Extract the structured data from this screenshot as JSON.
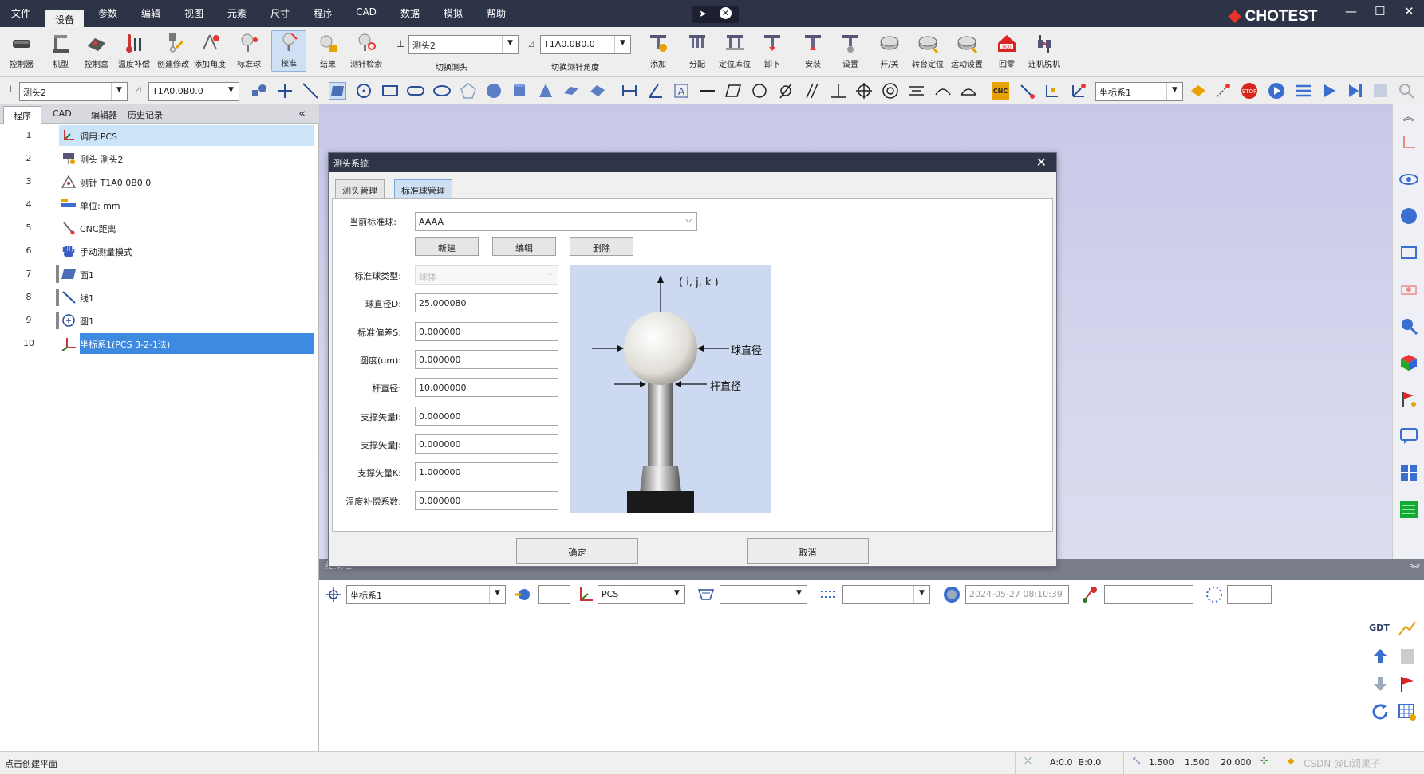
{
  "menubar": {
    "items": [
      "文件",
      "设备",
      "参数",
      "编辑",
      "视图",
      "元素",
      "尺寸",
      "程序",
      "CAD",
      "数据",
      "模拟",
      "帮助"
    ],
    "active": "设备"
  },
  "brand": "CHOTEST",
  "ribbon": {
    "buttons": [
      "控制器",
      "机型",
      "控制盒",
      "温度补偿",
      "创建修改",
      "添加角度",
      "标准球",
      "校准",
      "结果",
      "测针检索"
    ],
    "selected": "校准",
    "probe_select": "测头2",
    "probe_caption": "切换测头",
    "angle_select": "T1A0.0B0.0",
    "angle_caption": "切换测针角度",
    "buttons_right": [
      "添加",
      "分配",
      "定位库位",
      "卸下",
      "安装",
      "设置",
      "开/关",
      "转台定位",
      "运动设置",
      "回零",
      "连机脱机"
    ]
  },
  "toolbar2": {
    "probe_select": "测头2",
    "angle_select": "T1A0.0B0.0",
    "coord_select": "坐标系1",
    "cnc_badge": "CNC"
  },
  "left_panel": {
    "tabs": [
      "程序",
      "CAD",
      "编辑器",
      "历史记录"
    ],
    "active_tab": "程序",
    "collapse_icon": "«",
    "rows": [
      {
        "num": "1",
        "text": "调用:PCS",
        "icon": "axis-call-icon"
      },
      {
        "num": "2",
        "text": "测头 测头2",
        "icon": "probe-icon"
      },
      {
        "num": "3",
        "text": "测针 T1A0.0B0.0",
        "icon": "stylus-icon"
      },
      {
        "num": "4",
        "text": "单位: mm",
        "icon": "ruler-icon"
      },
      {
        "num": "5",
        "text": "CNC距离",
        "icon": "cnc-distance-icon"
      },
      {
        "num": "6",
        "text": "手动测量模式",
        "icon": "hand-icon"
      },
      {
        "num": "7",
        "text": "面1",
        "icon": "plane-icon"
      },
      {
        "num": "8",
        "text": "线1",
        "icon": "line-icon"
      },
      {
        "num": "9",
        "text": "圆1",
        "icon": "circle-icon"
      },
      {
        "num": "10",
        "text": "坐标系1(PCS  3-2-1法)",
        "icon": "coordinate-icon"
      }
    ]
  },
  "dialog": {
    "title": "测头系统",
    "tabs": [
      "测头管理",
      "标准球管理"
    ],
    "active_tab": "标准球管理",
    "current_ball_label": "当前标准球:",
    "current_ball_value": "AAAA",
    "btn_new": "新建",
    "btn_edit": "编辑",
    "btn_delete": "删除",
    "fields": [
      {
        "label": "标准球类型:",
        "value": "球体",
        "disabled": true
      },
      {
        "label": "球直径D:",
        "value": "25.000080"
      },
      {
        "label": "标准偏差S:",
        "value": "0.000000"
      },
      {
        "label": "圆度(um):",
        "value": "0.000000"
      },
      {
        "label": "杆直径:",
        "value": "10.000000"
      },
      {
        "label": "支撑矢量I:",
        "value": "0.000000"
      },
      {
        "label": "支撑矢量J:",
        "value": "0.000000"
      },
      {
        "label": "支撑矢量K:",
        "value": "1.000000"
      },
      {
        "label": "温度补偿系数:",
        "value": "0.000000"
      }
    ],
    "diagram": {
      "vector_label": "( i, j, k )",
      "ball_label": "球直径",
      "stem_label": "杆直径"
    },
    "ok": "确定",
    "cancel": "取消"
  },
  "results": {
    "header": "结果栏",
    "coord": "坐标系1",
    "ref": "PCS",
    "timestamp": "2024-05-27 08:10:39"
  },
  "results_right": {
    "gdt": "GDT"
  },
  "statusbar": {
    "hint": "点击创建平面",
    "angle": "A:0.0  B:0.0",
    "scale1": "1.500",
    "scale2": "1.500",
    "scale3": "20.000",
    "watermark": "CSDN @Li润果子"
  },
  "colors": {
    "titlebar": "#2d3447",
    "accent": "#3d8be0",
    "brand_red": "#e8332a"
  }
}
